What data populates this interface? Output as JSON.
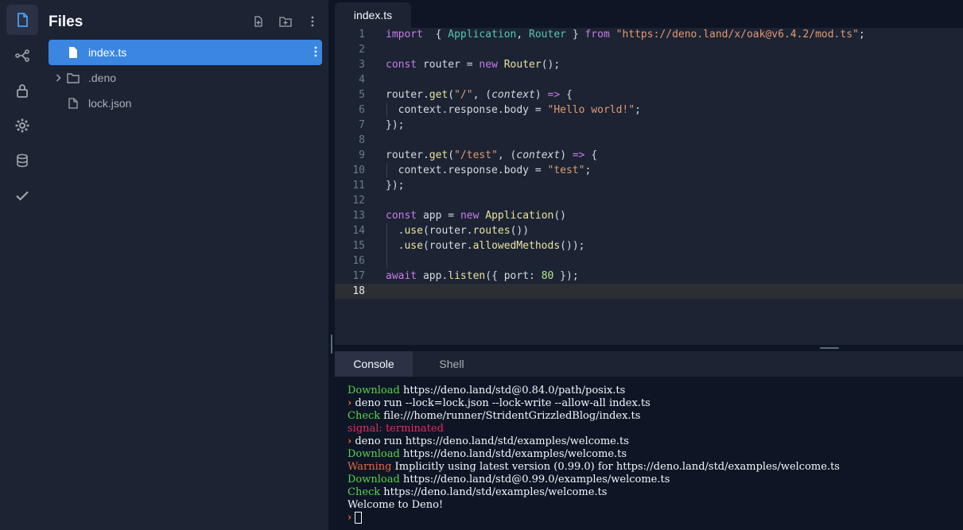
{
  "rail": {
    "items": [
      {
        "icon": "file-icon",
        "active": true
      },
      {
        "icon": "git-branch-icon"
      },
      {
        "icon": "lock-icon"
      },
      {
        "icon": "gear-icon"
      },
      {
        "icon": "database-icon"
      },
      {
        "icon": "check-icon"
      }
    ]
  },
  "files": {
    "title": "Files",
    "items": [
      {
        "label": "index.ts",
        "selected": true
      },
      {
        "label": ".deno",
        "type": "folder"
      },
      {
        "label": "lock.json"
      }
    ]
  },
  "editor": {
    "tab_label": "index.ts",
    "current_line": 18,
    "lines": [
      {
        "n": "1",
        "tokens": [
          [
            "k",
            "import"
          ],
          [
            "",
            "  { "
          ],
          [
            "t",
            "Application"
          ],
          [
            "",
            ", "
          ],
          [
            "t",
            "Router"
          ],
          [
            "",
            " } "
          ],
          [
            "k",
            "from"
          ],
          [
            "",
            " "
          ],
          [
            "s",
            "\"https://deno.land/x/oak@v6.4.2/mod.ts\""
          ],
          [
            "",
            ";"
          ]
        ]
      },
      {
        "n": "2",
        "tokens": []
      },
      {
        "n": "3",
        "tokens": [
          [
            "k",
            "const"
          ],
          [
            "",
            " router = "
          ],
          [
            "k",
            "new"
          ],
          [
            "",
            " "
          ],
          [
            "f",
            "Router"
          ],
          [
            "",
            "();"
          ]
        ]
      },
      {
        "n": "4",
        "tokens": []
      },
      {
        "n": "5",
        "tokens": [
          [
            "",
            "router."
          ],
          [
            "f",
            "get"
          ],
          [
            "",
            "("
          ],
          [
            "s",
            "\"/\""
          ],
          [
            "",
            ", ("
          ],
          [
            "i",
            "context"
          ],
          [
            "",
            ") "
          ],
          [
            "o",
            "=>"
          ],
          [
            "",
            " {"
          ]
        ]
      },
      {
        "n": "6",
        "tokens": [
          [
            "",
            "  context.response.body = "
          ],
          [
            "s",
            "\"Hello world!\""
          ],
          [
            "",
            ";"
          ]
        ],
        "guide": true
      },
      {
        "n": "7",
        "tokens": [
          [
            "",
            "});"
          ]
        ]
      },
      {
        "n": "8",
        "tokens": []
      },
      {
        "n": "9",
        "tokens": [
          [
            "",
            "router."
          ],
          [
            "f",
            "get"
          ],
          [
            "",
            "("
          ],
          [
            "s",
            "\"/test\""
          ],
          [
            "",
            ", ("
          ],
          [
            "i",
            "context"
          ],
          [
            "",
            ") "
          ],
          [
            "o",
            "=>"
          ],
          [
            "",
            " {"
          ]
        ]
      },
      {
        "n": "10",
        "tokens": [
          [
            "",
            "  context.response.body = "
          ],
          [
            "s",
            "\"test\""
          ],
          [
            "",
            ";"
          ]
        ],
        "guide": true
      },
      {
        "n": "11",
        "tokens": [
          [
            "",
            "});"
          ]
        ]
      },
      {
        "n": "12",
        "tokens": []
      },
      {
        "n": "13",
        "tokens": [
          [
            "k",
            "const"
          ],
          [
            "",
            " app = "
          ],
          [
            "k",
            "new"
          ],
          [
            "",
            " "
          ],
          [
            "f",
            "Application"
          ],
          [
            "",
            "()"
          ]
        ]
      },
      {
        "n": "14",
        "tokens": [
          [
            "",
            "  ."
          ],
          [
            "f",
            "use"
          ],
          [
            "",
            "(router."
          ],
          [
            "f",
            "routes"
          ],
          [
            "",
            "())"
          ]
        ],
        "guide": true
      },
      {
        "n": "15",
        "tokens": [
          [
            "",
            "  ."
          ],
          [
            "f",
            "use"
          ],
          [
            "",
            "(router."
          ],
          [
            "f",
            "allowedMethods"
          ],
          [
            "",
            "());"
          ]
        ],
        "guide": true
      },
      {
        "n": "16",
        "tokens": [],
        "guide": true
      },
      {
        "n": "17",
        "tokens": [
          [
            "k",
            "await"
          ],
          [
            "",
            " app."
          ],
          [
            "f",
            "listen"
          ],
          [
            "",
            "({ port: "
          ],
          [
            "n",
            "80"
          ],
          [
            "",
            " });"
          ]
        ]
      },
      {
        "n": "18",
        "tokens": []
      }
    ]
  },
  "console_tabs": {
    "console": "Console",
    "shell": "Shell"
  },
  "console": {
    "lines": [
      [
        [
          "g",
          "Download"
        ],
        [
          "",
          " https://deno.land/std@0.84.0/path/posix.ts"
        ]
      ],
      [
        [
          "p",
          "›"
        ],
        [
          "",
          " deno run --lock=lock.json --lock-write --allow-all index.ts"
        ]
      ],
      [
        [
          "g",
          "Check"
        ],
        [
          "",
          " file:///home/runner/StridentGrizzledBlog/index.ts"
        ]
      ],
      [
        [
          "r",
          "signal: terminated"
        ]
      ],
      [
        [
          "p",
          "›"
        ],
        [
          "",
          " deno run https://deno.land/std/examples/welcome.ts"
        ]
      ],
      [
        [
          "g",
          "Download"
        ],
        [
          "",
          " https://deno.land/std/examples/welcome.ts"
        ]
      ],
      [
        [
          "w",
          "Warning"
        ],
        [
          "",
          " Implicitly using latest version (0.99.0) for https://deno.land/std/examples/welcome.ts"
        ]
      ],
      [
        [
          "g",
          "Download"
        ],
        [
          "",
          " https://deno.land/std@0.99.0/examples/welcome.ts"
        ]
      ],
      [
        [
          "g",
          "Check"
        ],
        [
          "",
          " https://deno.land/std/examples/welcome.ts"
        ]
      ],
      [
        [
          "",
          "Welcome to Deno!"
        ]
      ]
    ],
    "prompt": "›"
  }
}
